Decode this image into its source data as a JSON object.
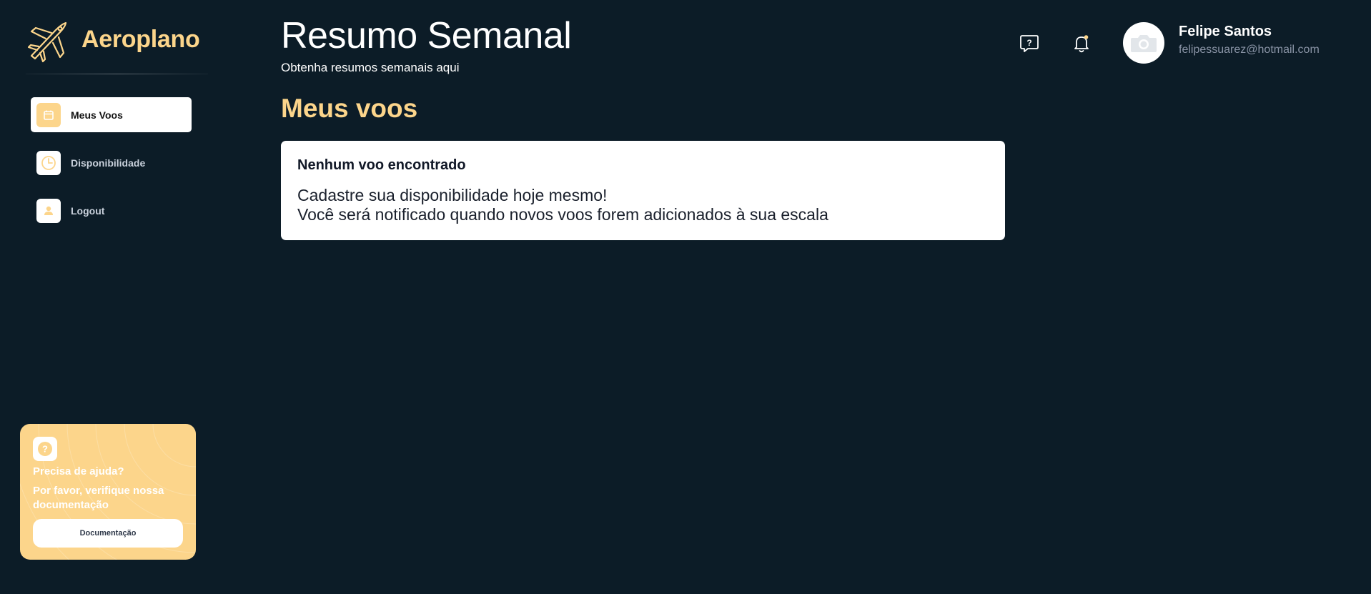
{
  "brand": {
    "name": "Aeroplano",
    "icon": "airplane-icon"
  },
  "nav": {
    "items": [
      {
        "label": "Meus Voos",
        "icon": "calendar-icon",
        "active": true
      },
      {
        "label": "Disponibilidade",
        "icon": "clock-icon",
        "active": false
      },
      {
        "label": "Logout",
        "icon": "user-icon",
        "active": false
      }
    ]
  },
  "help": {
    "title": "Precisa de ajuda?",
    "text": "Por favor, verifique nossa documentação",
    "button": "Documentação",
    "icon": "question-icon"
  },
  "header": {
    "title": "Resumo Semanal",
    "subtitle": "Obtenha resumos semanais aqui",
    "icons": [
      "help-chat-icon",
      "bell-icon"
    ]
  },
  "user": {
    "name": "Felipe Santos",
    "email": "felipessuarez@hotmail.com",
    "avatar_icon": "camera-icon"
  },
  "main": {
    "section_title": "Meus voos",
    "empty": {
      "title": "Nenhum voo encontrado",
      "line1": "Cadastre sua disponibilidade hoje mesmo!",
      "line2": "Você será notificado quando novos voos forem adicionados à sua escala"
    }
  },
  "colors": {
    "background": "#0c1c27",
    "accent": "#fcd58b",
    "card": "#ffffff",
    "muted_text": "#8a94a6"
  }
}
